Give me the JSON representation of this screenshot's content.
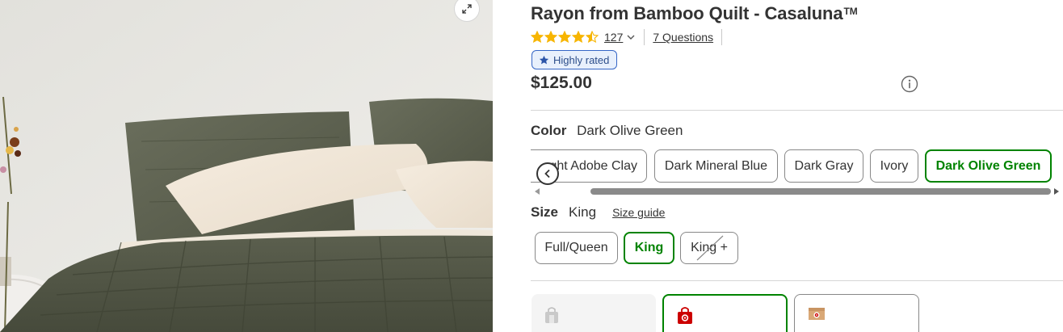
{
  "product": {
    "title": "Rayon from Bamboo Quilt - Casaluna",
    "trademark": "TM",
    "rating_value": 4.5,
    "rating_count": "127",
    "questions_link": "7 Questions",
    "badge_label": "Highly rated",
    "price": "$125.00"
  },
  "color": {
    "label": "Color",
    "selected_value": "Dark Olive Green",
    "options": [
      "Light Adobe Clay",
      "Dark Mineral Blue",
      "Dark Gray",
      "Ivory",
      "Dark Olive Green"
    ],
    "partially_visible_first_option_text": "ght Adobe Clay"
  },
  "size": {
    "label": "Size",
    "selected_value": "King",
    "guide_link": "Size guide",
    "options": [
      "Full/Queen",
      "King",
      "King +"
    ],
    "unavailable_option": "King +"
  },
  "fulfillment": {
    "options": [
      "pickup",
      "same-day-delivery",
      "shipping"
    ],
    "selected": "same-day-delivery",
    "disabled": "pickup"
  },
  "colors": {
    "accent_green": "#008300",
    "badge_blue": "#3566c6",
    "star_gold": "#f7b500",
    "quilt_olive": "#585c4b"
  },
  "icons": {
    "expand": "expand-icon",
    "info": "info-icon",
    "carousel_prev": "chevron-left-icon",
    "rating_dropdown": "chevron-down-icon"
  }
}
